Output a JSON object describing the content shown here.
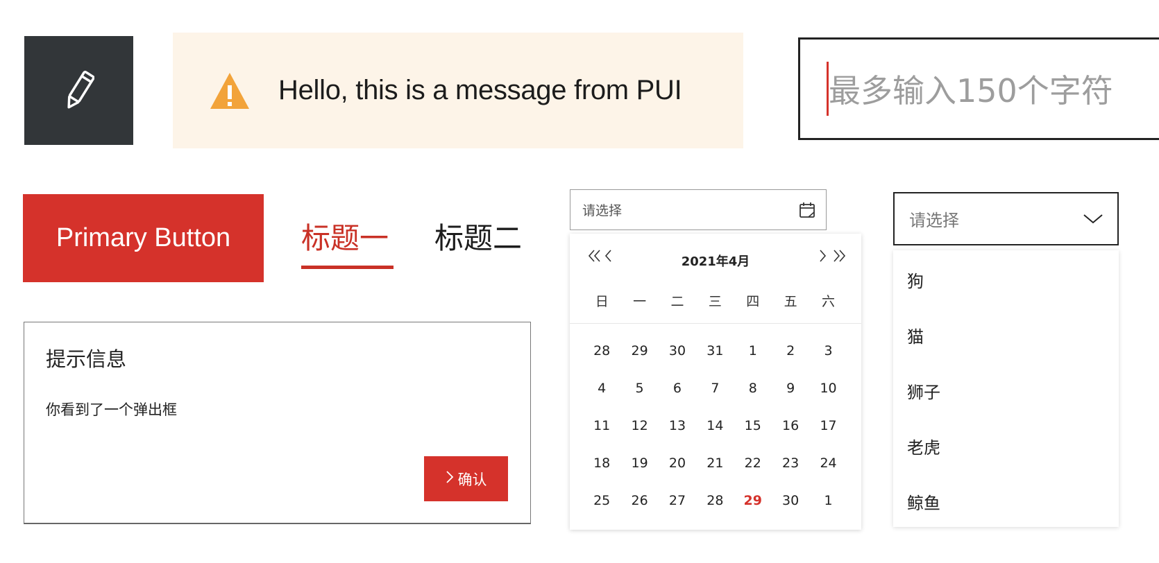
{
  "icon_button": {
    "icon": "pencil-icon"
  },
  "message": {
    "icon": "warning-icon",
    "text": "Hello, this is a message from PUI",
    "bg_color": "#fdf4e8",
    "icon_color": "#f2a33a"
  },
  "text_input": {
    "placeholder": "最多输入150个字符"
  },
  "primary_button": {
    "label": "Primary Button",
    "color": "#d5322b"
  },
  "tabs": [
    {
      "label": "标题一",
      "active": true
    },
    {
      "label": "标题二",
      "active": false
    }
  ],
  "dialog": {
    "title": "提示信息",
    "body": "你看到了一个弹出框",
    "confirm_label": "确认"
  },
  "date_picker": {
    "placeholder": "请选择",
    "month_label": "2021年4月",
    "weekdays": [
      "日",
      "一",
      "二",
      "三",
      "四",
      "五",
      "六"
    ],
    "weeks": [
      [
        "28",
        "29",
        "30",
        "31",
        "1",
        "2",
        "3"
      ],
      [
        "4",
        "5",
        "6",
        "7",
        "8",
        "9",
        "10"
      ],
      [
        "11",
        "12",
        "13",
        "14",
        "15",
        "16",
        "17"
      ],
      [
        "18",
        "19",
        "20",
        "21",
        "22",
        "23",
        "24"
      ],
      [
        "25",
        "26",
        "27",
        "28",
        "29",
        "30",
        "1"
      ]
    ],
    "today": "29"
  },
  "select": {
    "placeholder": "请选择",
    "options": [
      "狗",
      "猫",
      "狮子",
      "老虎",
      "鲸鱼"
    ]
  }
}
